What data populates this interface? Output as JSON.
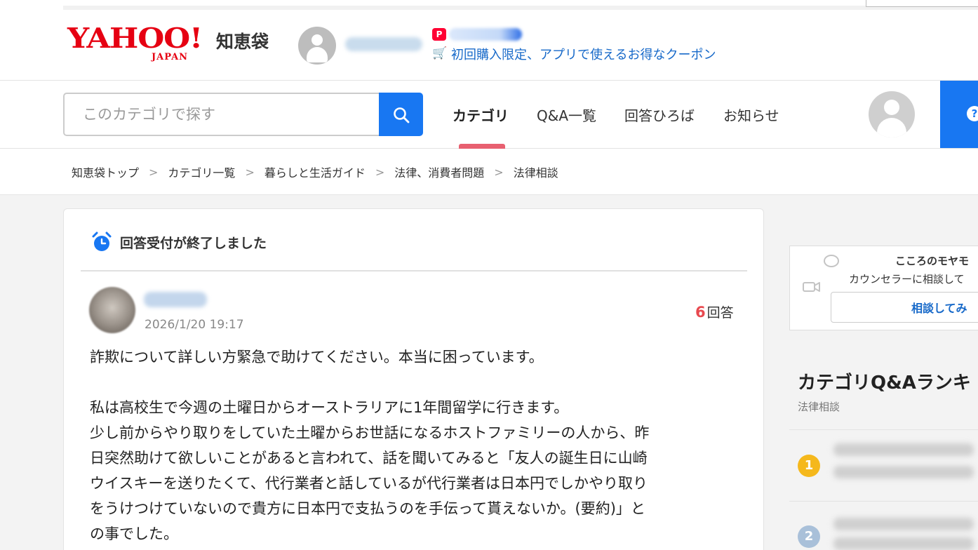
{
  "header": {
    "logo_yahoo": "YAHOO!",
    "logo_japan": "JAPAN",
    "service_name": "知恵袋",
    "paypay_badge": "P",
    "coupon_link": "初回購入限定、アプリで使えるお得なクーポン"
  },
  "nav": {
    "search_placeholder": "このカテゴリで探す",
    "tabs": [
      "カテゴリ",
      "Q&A一覧",
      "回答ひろば",
      "お知らせ"
    ],
    "active_tab": "カテゴリ",
    "ask_icon": "?"
  },
  "breadcrumb": [
    "知恵袋トップ",
    "カテゴリ一覧",
    "暮らしと生活ガイド",
    "法律、消費者問題",
    "法律相談"
  ],
  "question": {
    "closed_notice": "回答受付が終了しました",
    "date": "2026/1/20 19:17",
    "answer_count": "6",
    "answer_label": "回答",
    "lines": [
      "詐欺について詳しい方緊急で助けてください。本当に困っています。",
      "",
      "私は高校生で今週の土曜日からオーストラリアに1年間留学に行きます。",
      "少し前からやり取りをしていた土曜からお世話になるホストファミリーの人から、昨",
      "日突然助けて欲しいことがあると言われて、話を聞いてみると「友人の誕生日に山崎",
      "ウイスキーを送りたくて、代行業者と話しているが代行業者は日本円でしかやり取り",
      "をうけつけていないので貴方に日本円で支払うのを手伝って貰えないか。(要約)」と",
      "の事でした。"
    ]
  },
  "sidebar": {
    "counsel_line1": "こころのモヤモ",
    "counsel_line2": "カウンセラーに相談して",
    "counsel_button": "相談してみ",
    "ranking_title": "カテゴリQ&Aランキ",
    "ranking_category": "法律相談",
    "ranks": [
      "1",
      "2"
    ]
  },
  "colors": {
    "yahoo_red": "#e60012",
    "link_blue": "#1769c9",
    "primary_blue": "#1877f2",
    "tab_underline": "#e86070",
    "answer_count_red": "#e8494f",
    "rank1_gold": "#f5b81c",
    "rank2_blue": "#a9c0d9"
  }
}
